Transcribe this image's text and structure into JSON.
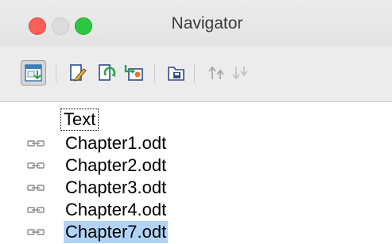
{
  "window": {
    "title": "Navigator"
  },
  "toolbar": {
    "buttons": [
      {
        "name": "toggle-master-view-icon",
        "active": true
      },
      {
        "name": "edit-icon"
      },
      {
        "name": "update-icon"
      },
      {
        "name": "insert-icon"
      },
      {
        "name": "save-contents-icon"
      },
      {
        "name": "move-up-icon"
      },
      {
        "name": "move-down-icon"
      }
    ]
  },
  "tree": {
    "root_label": "Text",
    "items": [
      {
        "label": "Chapter1.odt",
        "icon": "link-icon",
        "selected": false
      },
      {
        "label": "Chapter2.odt",
        "icon": "link-icon",
        "selected": false
      },
      {
        "label": "Chapter3.odt",
        "icon": "link-icon",
        "selected": false
      },
      {
        "label": "Chapter4.odt",
        "icon": "link-icon",
        "selected": false
      },
      {
        "label": "Chapter7.odt",
        "icon": "link-icon",
        "selected": true
      }
    ]
  },
  "colors": {
    "selection": "#b3d3f6",
    "close": "#fc5f57",
    "maximize": "#2ac840"
  }
}
